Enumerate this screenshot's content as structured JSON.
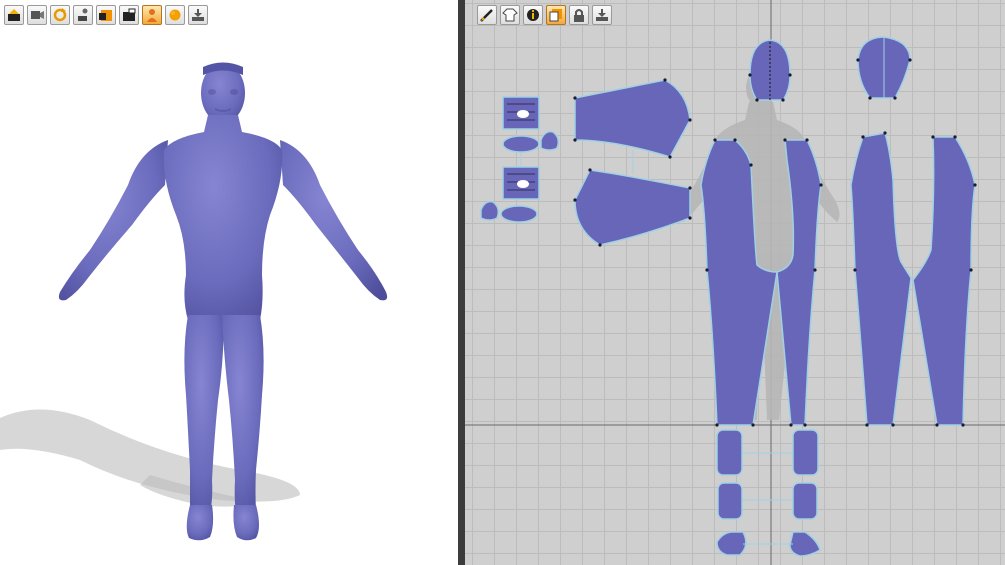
{
  "app": {
    "accent_color": "#f3a93a",
    "avatar_color": "#6b6bbd",
    "pattern_fill_color": "#6866b8",
    "grid_background_color": "#cfcfcf"
  },
  "toolbar_3d": {
    "icons": [
      "simulate-icon",
      "record-icon",
      "sync-icon",
      "avatar-pose-icon",
      "texture-icon",
      "camera-icon",
      "show-avatar-icon",
      "show-garment-icon",
      "export-icon"
    ]
  },
  "toolbar_2d": {
    "icons": [
      "edit-pattern-icon",
      "garment-icon",
      "info-icon",
      "texture-icon",
      "lock-icon",
      "export-icon"
    ]
  }
}
